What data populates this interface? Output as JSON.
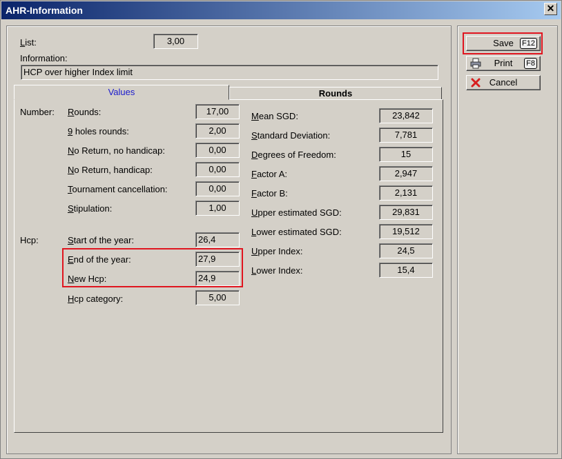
{
  "window": {
    "title": "AHR-Information",
    "close_glyph": "✕"
  },
  "header": {
    "list_label": "List:",
    "list_value": "3,00",
    "info_label": "Information:",
    "info_value": "HCP over higher Index limit"
  },
  "tabs": [
    {
      "label": "Values",
      "active": true
    },
    {
      "label": "Rounds",
      "active": false
    }
  ],
  "number_section": {
    "group_label": "Number:",
    "items": [
      {
        "label": "Rounds:",
        "value": "17,00"
      },
      {
        "label": "9 holes rounds:",
        "value": "2,00"
      },
      {
        "label": "No Return, no handicap:",
        "value": "0,00"
      },
      {
        "label": "No Return, handicap:",
        "value": "0,00"
      },
      {
        "label": "Tournament cancellation:",
        "value": "0,00"
      },
      {
        "label": "Stipulation:",
        "value": "1,00"
      }
    ]
  },
  "hcp_section": {
    "group_label": "Hcp:",
    "items": [
      {
        "label": "Start of the year:",
        "value": "26,4"
      },
      {
        "label": "End of the year:",
        "value": "27,9"
      },
      {
        "label": "New Hcp:",
        "value": "24,9"
      },
      {
        "label": "Hcp category:",
        "value": "5,00"
      }
    ]
  },
  "stats": [
    {
      "label": "Mean SGD:",
      "value": "23,842"
    },
    {
      "label": "Standard Deviation:",
      "value": "7,781"
    },
    {
      "label": "Degrees of Freedom:",
      "value": "15"
    },
    {
      "label": "Factor A:",
      "value": "2,947"
    },
    {
      "label": "Factor B:",
      "value": "2,131"
    },
    {
      "label": "Upper estimated SGD:",
      "value": "29,831"
    },
    {
      "label": "Lower estimated SGD:",
      "value": "19,512"
    },
    {
      "label": "Upper Index:",
      "value": "24,5"
    },
    {
      "label": "Lower Index:",
      "value": "15,4"
    }
  ],
  "buttons": {
    "save": {
      "label": "Save",
      "key": "F12"
    },
    "print": {
      "label": "Print",
      "key": "F8"
    },
    "cancel": {
      "label": "Cancel"
    }
  },
  "colors": {
    "highlight": "#e0141e",
    "title_bar": "#0a246a",
    "active_tab_text": "#1a1acd"
  }
}
